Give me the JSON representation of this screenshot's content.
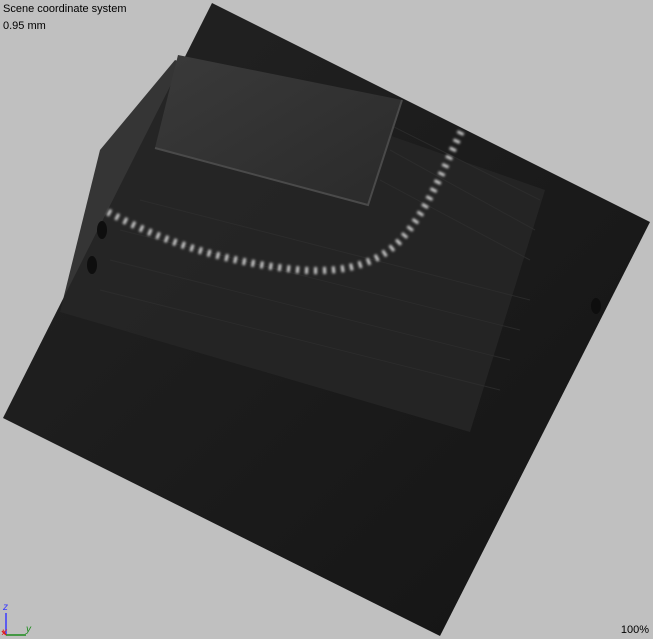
{
  "viewport": {
    "title": "Scene coordinate system",
    "scale_label": "0.95 mm",
    "zoom_label": "100%"
  },
  "axes": {
    "z_label": "z",
    "y_label": "y",
    "x_label": "x",
    "z_color": "#3a3aff",
    "y_color": "#1a8a1a",
    "x_color": "#e02020"
  },
  "colors": {
    "background": "#c0c0c0",
    "volume_dark": "#1a1a1a",
    "volume_mid": "#262626",
    "slab": "#323232"
  },
  "icons": {
    "axis_gizmo": "xyz-axis-triad-icon"
  }
}
